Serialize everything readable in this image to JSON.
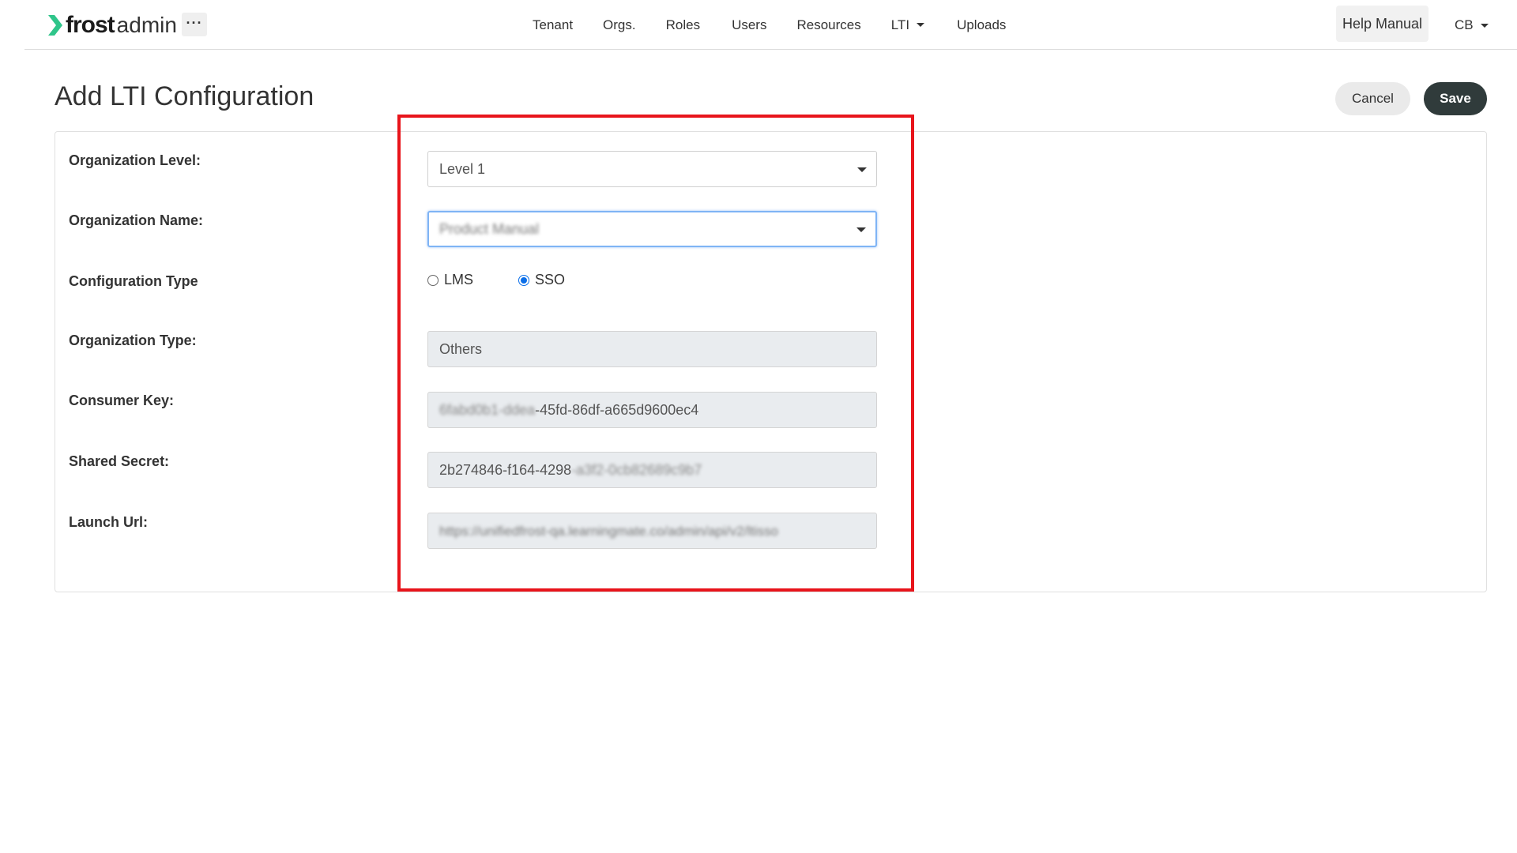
{
  "brand": {
    "frost": "frost",
    "admin": "admin",
    "accent": "#2fc58a"
  },
  "navbar": {
    "more_label": "···",
    "links": [
      "Tenant",
      "Orgs.",
      "Roles",
      "Users",
      "Resources",
      "LTI",
      "Uploads"
    ],
    "help_label": "Help Manual",
    "user_initials": "CB"
  },
  "page": {
    "title": "Add LTI Configuration",
    "cancel_label": "Cancel",
    "save_label": "Save"
  },
  "form": {
    "org_level_label": "Organization Level:",
    "org_level_value": "Level 1",
    "org_name_label": "Organization Name:",
    "org_name_value": "Product Manual",
    "config_type_label": "Configuration Type",
    "config_type_options": [
      "LMS",
      "SSO"
    ],
    "config_type_selected": "SSO",
    "org_type_label": "Organization Type:",
    "org_type_value": "Others",
    "consumer_key_label": "Consumer Key:",
    "consumer_key_hidden": "6fabd0b1-ddea",
    "consumer_key_visible": "-45fd-86df-a665d9600ec4",
    "shared_secret_label": "Shared Secret:",
    "shared_secret_visible": "2b274846-f164-4298",
    "shared_secret_hidden": "-a3f2-0cb82689c9b7",
    "launch_url_label": "Launch Url:",
    "launch_url_value": "https://unifiedfrost-qa.learningmate.co/admin/api/v2/ltisso"
  },
  "colors": {
    "save_bg": "#303b3b",
    "highlight": "#e8141b",
    "radio_checked": "#0a6ee8"
  }
}
